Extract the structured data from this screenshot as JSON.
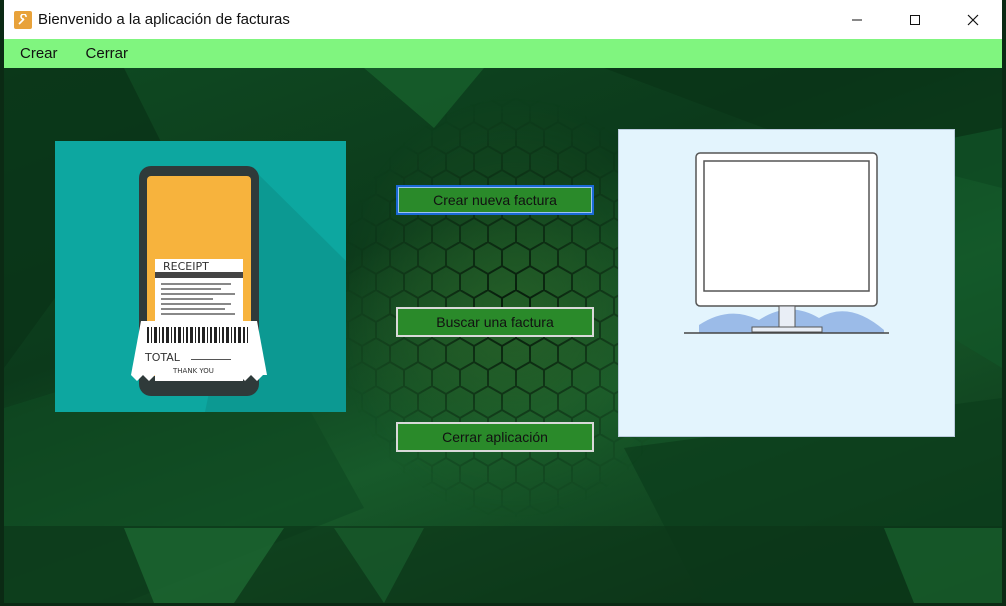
{
  "window": {
    "title": "Bienvenido a la aplicación de facturas",
    "controls": [
      "minimize-icon",
      "maximize-icon",
      "close-icon"
    ]
  },
  "menu": {
    "items": [
      {
        "label": "Crear"
      },
      {
        "label": "Cerrar"
      }
    ]
  },
  "buttons": {
    "create": "Crear nueva factura",
    "search": "Buscar una factura",
    "close": "Cerrar aplicación"
  },
  "receipt_image": {
    "header": "RECEIPT",
    "total": "TOTAL",
    "thanks": "THANK YOU"
  },
  "colors": {
    "menubar": "#80f57f",
    "button": "#2a8a2a",
    "focus_border": "#1a6ad6"
  }
}
